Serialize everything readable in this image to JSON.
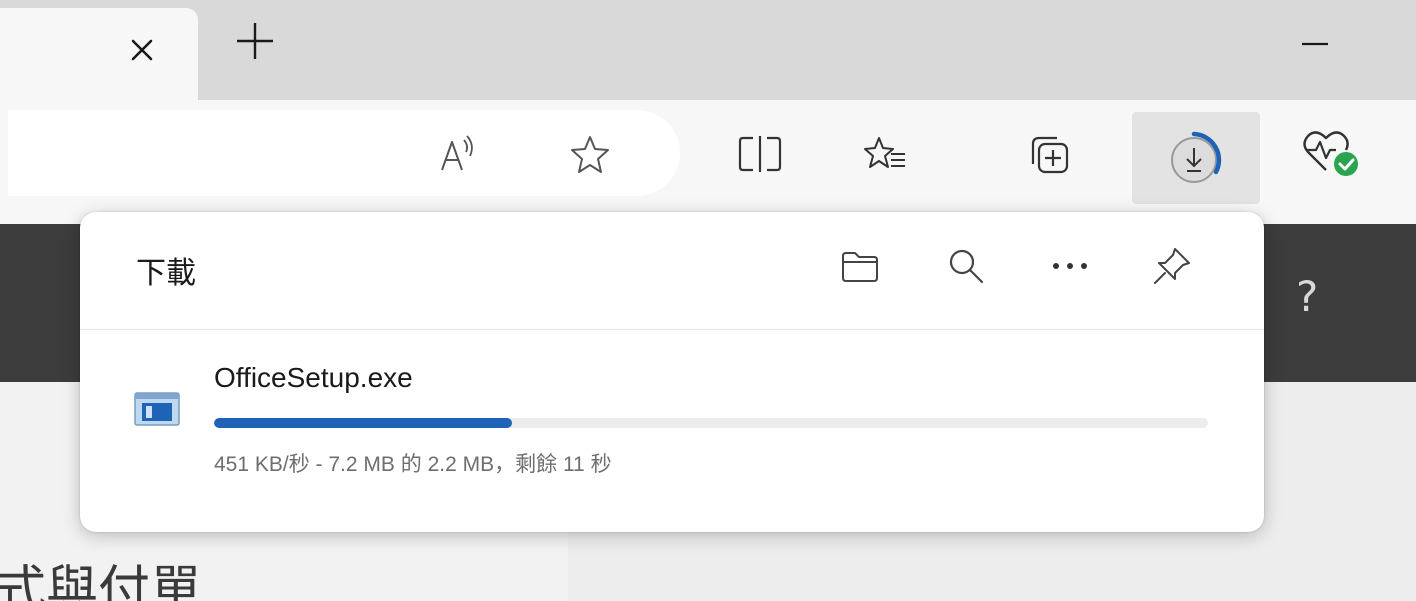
{
  "tabstrip": {
    "close_glyph": "×",
    "new_tab_glyph": "+",
    "minimize_glyph": "—"
  },
  "toolbar": {
    "read_aloud_icon": "read-aloud-icon",
    "favorite_icon": "star-icon",
    "split_screen_icon": "split-screen-icon",
    "favorites_icon": "favorites-list-icon",
    "collections_icon": "collections-icon",
    "downloads_icon": "download-icon",
    "health_icon": "browser-essentials-icon"
  },
  "page": {
    "help_label": "?",
    "heading": "式與付單"
  },
  "downloads": {
    "title": "下載",
    "item": {
      "file_name": "OfficeSetup.exe",
      "progress": 0.3,
      "status": "451 KB/秒 - 7.2 MB 的 2.2 MB，剩餘 11 秒"
    }
  },
  "colors": {
    "accent": "#1f63b6",
    "dark_band": "#3c3c3c",
    "health_badge": "#2aa44f"
  }
}
